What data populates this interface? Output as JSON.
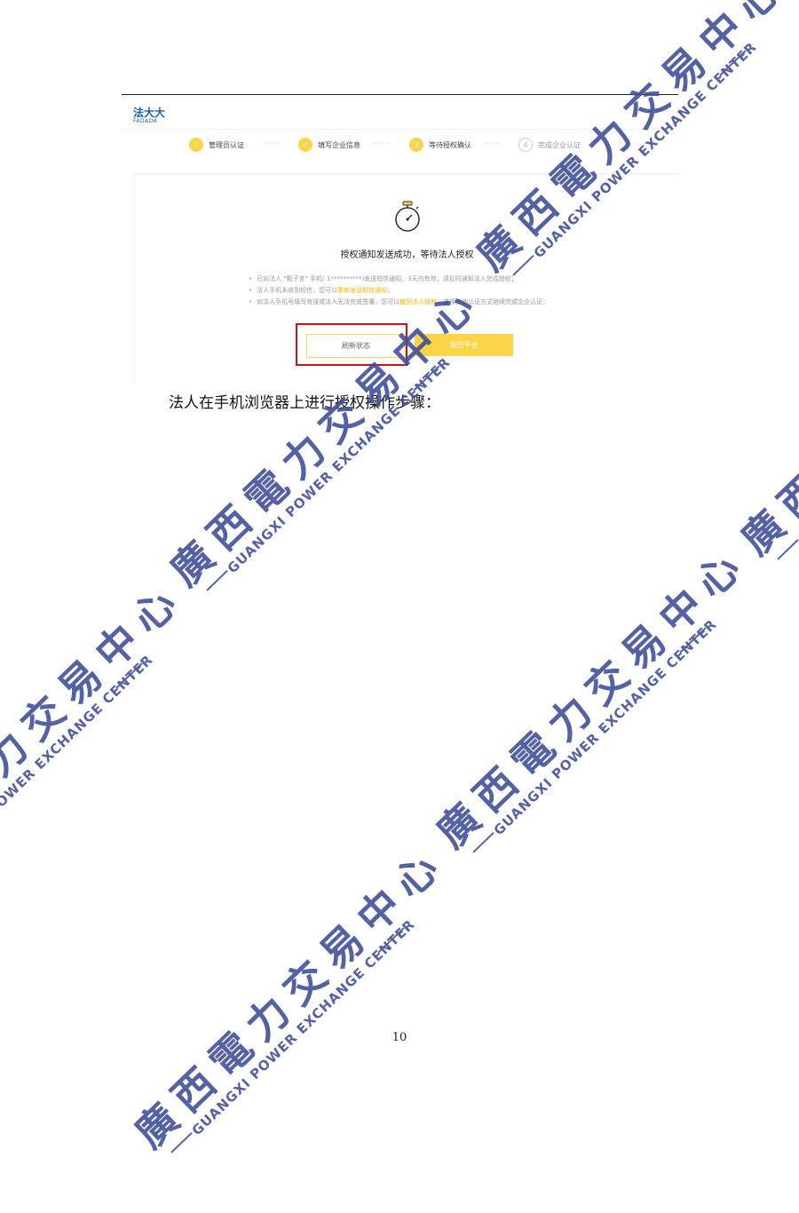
{
  "screenshot": {
    "logo": {
      "cn": "法大大",
      "en": "FADADA"
    },
    "steps": [
      {
        "num": "✓",
        "label": "管理员认证",
        "state": "done"
      },
      {
        "num": "✓",
        "label": "填写企业信息",
        "state": "done"
      },
      {
        "num": "3",
        "label": "等待授权确认",
        "state": "current"
      },
      {
        "num": "4",
        "label": "完成企业认证",
        "state": "pending"
      }
    ],
    "step_separator": "·····",
    "panel_title": "授权通知发送成功，等待法人授权",
    "notes": [
      {
        "pre": "已向法人 \"甄子言\" 手机( 1**********)发送短信通知，3天内有效，请及时通知法人完成授权；",
        "link": "",
        "post": ""
      },
      {
        "pre": "法人手机未收到短信，您可以",
        "link": "重新发送短信通知",
        "post": "；"
      },
      {
        "pre": "如法人手机号填写有误或法人无法完成签署，您可以",
        "link": "撤回法人授权",
        "post": "，选择其他认证方式继续完成企业认证；"
      }
    ],
    "refresh_button": "刷新状态",
    "back_button": "返回平台"
  },
  "body_text": "法人在手机浏览器上进行授权操作步骤：",
  "page_number": "10",
  "watermark": {
    "cn": "廣西電力交易中心",
    "en": "GUANGXI POWER EXCHANGE CENTER"
  },
  "colors": {
    "accent_yellow": "#fcd448",
    "logo_blue": "#1b5fa8",
    "highlight_red": "#c8141e",
    "watermark_blue": "#3d4c97"
  },
  "icons": {
    "timer": "stopwatch-icon",
    "step_done": "check-icon"
  }
}
